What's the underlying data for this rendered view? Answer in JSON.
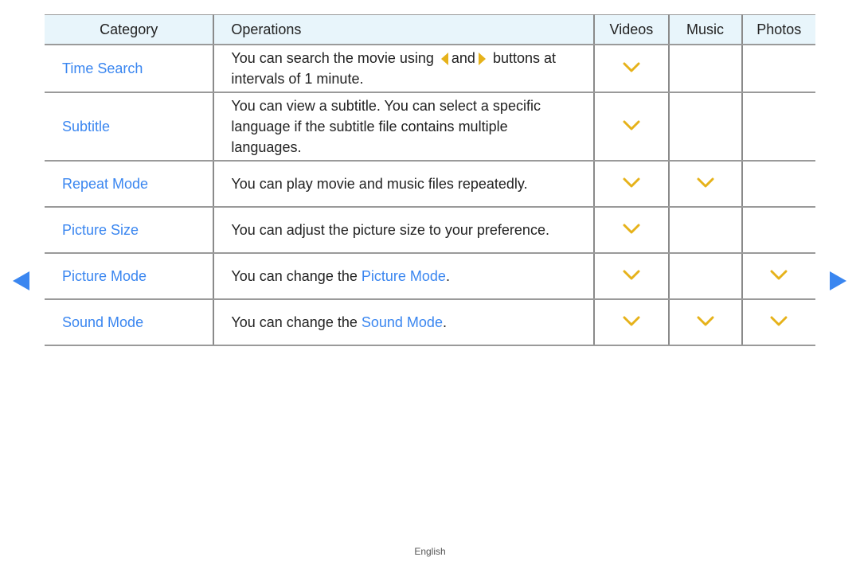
{
  "table": {
    "headers": {
      "category": "Category",
      "operations": "Operations",
      "videos": "Videos",
      "music": "Music",
      "photos": "Photos"
    },
    "rows": [
      {
        "category": "Time Search",
        "op_parts": [
          "You can search the movie using",
          "and",
          "buttons at intervals of 1 minute."
        ],
        "videos": true,
        "music": false,
        "photos": false
      },
      {
        "category": "Subtitle",
        "op_text": "You can view a subtitle. You can select a specific language if the subtitle file contains multiple languages.",
        "videos": true,
        "music": false,
        "photos": false
      },
      {
        "category": "Repeat Mode",
        "op_text": "You can play movie and music files repeatedly.",
        "videos": true,
        "music": true,
        "photos": false
      },
      {
        "category": "Picture Size",
        "op_text": "You can adjust the picture size to your preference.",
        "videos": true,
        "music": false,
        "photos": false
      },
      {
        "category": "Picture Mode",
        "op_prefix": "You can change the",
        "op_link": "Picture Mode",
        "op_suffix": ".",
        "videos": true,
        "music": false,
        "photos": true
      },
      {
        "category": "Sound Mode",
        "op_prefix": "You can change the",
        "op_link": "Sound Mode",
        "op_suffix": ".",
        "videos": true,
        "music": true,
        "photos": true
      }
    ]
  },
  "icons": {
    "check": "checkmark-chevron-icon",
    "prev": "previous-page-icon",
    "next": "next-page-icon",
    "left_button": "left-arrow-button-icon",
    "right_button": "right-arrow-button-icon"
  },
  "colors": {
    "accent_blue": "#3a86f0",
    "check_yellow": "#e6b21a",
    "header_bg": "#e8f5fb"
  },
  "footer": {
    "language": "English"
  }
}
